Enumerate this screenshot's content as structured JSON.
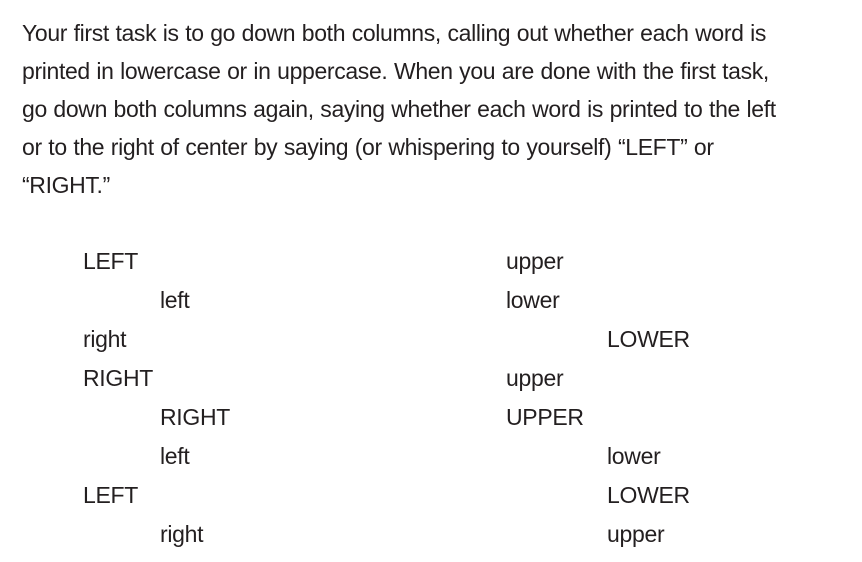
{
  "instructions": {
    "lines": [
      "Your first task is to go down both columns, calling out whether each word is",
      "printed in lowercase or in uppercase. When you are done with the first task,",
      "go down both columns again, saying whether each word is printed to the left",
      "or to the right of center by saying (or whispering to yourself) “LEFT” or",
      "“RIGHT.”"
    ]
  },
  "column_a": {
    "words": [
      "LEFT",
      "left",
      "right",
      "RIGHT",
      "RIGHT",
      "left",
      "LEFT",
      "right"
    ]
  },
  "column_b": {
    "words": [
      "upper",
      "lower",
      "LOWER",
      "upper",
      "UPPER",
      "lower",
      "LOWER",
      "upper"
    ]
  }
}
